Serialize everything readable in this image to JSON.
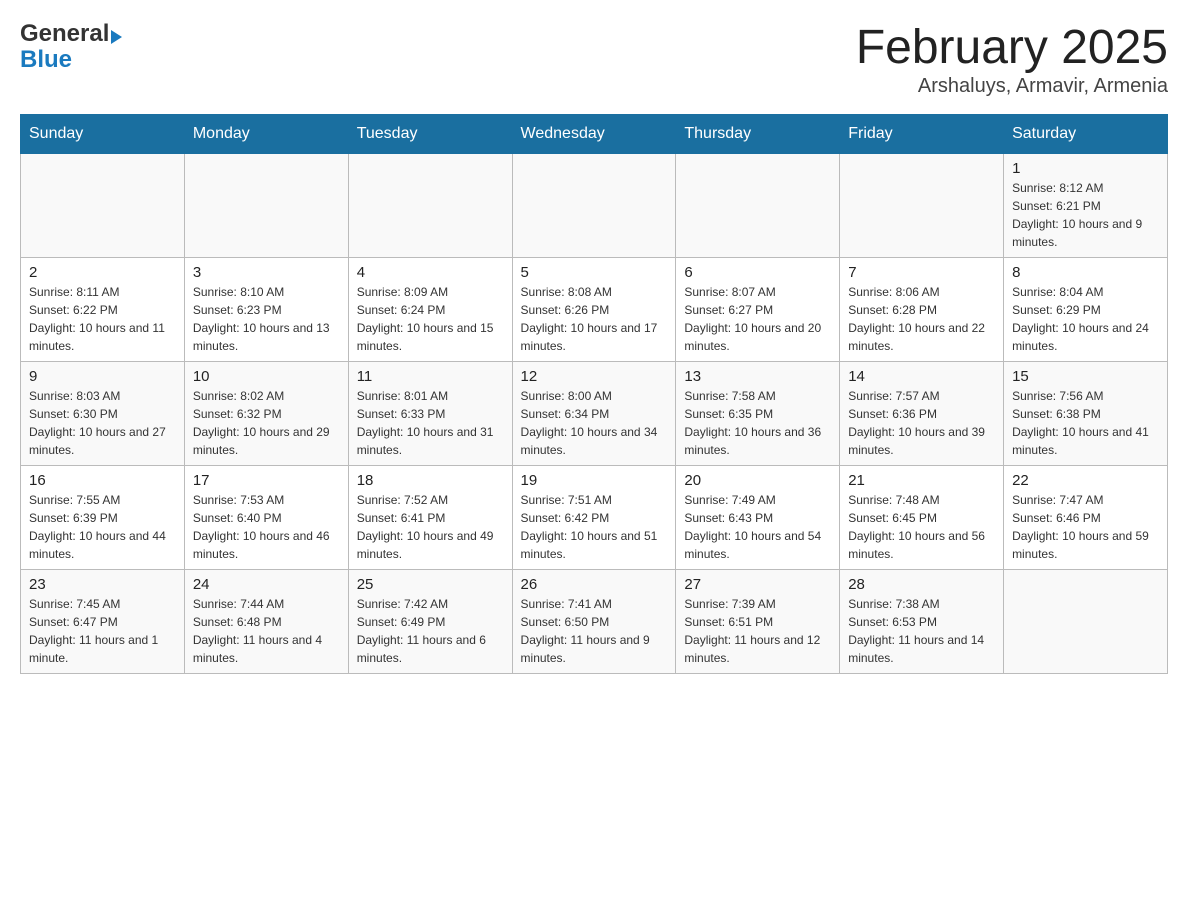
{
  "header": {
    "logo_general": "General",
    "logo_blue": "Blue",
    "title": "February 2025",
    "subtitle": "Arshaluys, Armavir, Armenia"
  },
  "days_of_week": [
    "Sunday",
    "Monday",
    "Tuesday",
    "Wednesday",
    "Thursday",
    "Friday",
    "Saturday"
  ],
  "weeks": [
    [
      {
        "day": "",
        "info": ""
      },
      {
        "day": "",
        "info": ""
      },
      {
        "day": "",
        "info": ""
      },
      {
        "day": "",
        "info": ""
      },
      {
        "day": "",
        "info": ""
      },
      {
        "day": "",
        "info": ""
      },
      {
        "day": "1",
        "info": "Sunrise: 8:12 AM\nSunset: 6:21 PM\nDaylight: 10 hours and 9 minutes."
      }
    ],
    [
      {
        "day": "2",
        "info": "Sunrise: 8:11 AM\nSunset: 6:22 PM\nDaylight: 10 hours and 11 minutes."
      },
      {
        "day": "3",
        "info": "Sunrise: 8:10 AM\nSunset: 6:23 PM\nDaylight: 10 hours and 13 minutes."
      },
      {
        "day": "4",
        "info": "Sunrise: 8:09 AM\nSunset: 6:24 PM\nDaylight: 10 hours and 15 minutes."
      },
      {
        "day": "5",
        "info": "Sunrise: 8:08 AM\nSunset: 6:26 PM\nDaylight: 10 hours and 17 minutes."
      },
      {
        "day": "6",
        "info": "Sunrise: 8:07 AM\nSunset: 6:27 PM\nDaylight: 10 hours and 20 minutes."
      },
      {
        "day": "7",
        "info": "Sunrise: 8:06 AM\nSunset: 6:28 PM\nDaylight: 10 hours and 22 minutes."
      },
      {
        "day": "8",
        "info": "Sunrise: 8:04 AM\nSunset: 6:29 PM\nDaylight: 10 hours and 24 minutes."
      }
    ],
    [
      {
        "day": "9",
        "info": "Sunrise: 8:03 AM\nSunset: 6:30 PM\nDaylight: 10 hours and 27 minutes."
      },
      {
        "day": "10",
        "info": "Sunrise: 8:02 AM\nSunset: 6:32 PM\nDaylight: 10 hours and 29 minutes."
      },
      {
        "day": "11",
        "info": "Sunrise: 8:01 AM\nSunset: 6:33 PM\nDaylight: 10 hours and 31 minutes."
      },
      {
        "day": "12",
        "info": "Sunrise: 8:00 AM\nSunset: 6:34 PM\nDaylight: 10 hours and 34 minutes."
      },
      {
        "day": "13",
        "info": "Sunrise: 7:58 AM\nSunset: 6:35 PM\nDaylight: 10 hours and 36 minutes."
      },
      {
        "day": "14",
        "info": "Sunrise: 7:57 AM\nSunset: 6:36 PM\nDaylight: 10 hours and 39 minutes."
      },
      {
        "day": "15",
        "info": "Sunrise: 7:56 AM\nSunset: 6:38 PM\nDaylight: 10 hours and 41 minutes."
      }
    ],
    [
      {
        "day": "16",
        "info": "Sunrise: 7:55 AM\nSunset: 6:39 PM\nDaylight: 10 hours and 44 minutes."
      },
      {
        "day": "17",
        "info": "Sunrise: 7:53 AM\nSunset: 6:40 PM\nDaylight: 10 hours and 46 minutes."
      },
      {
        "day": "18",
        "info": "Sunrise: 7:52 AM\nSunset: 6:41 PM\nDaylight: 10 hours and 49 minutes."
      },
      {
        "day": "19",
        "info": "Sunrise: 7:51 AM\nSunset: 6:42 PM\nDaylight: 10 hours and 51 minutes."
      },
      {
        "day": "20",
        "info": "Sunrise: 7:49 AM\nSunset: 6:43 PM\nDaylight: 10 hours and 54 minutes."
      },
      {
        "day": "21",
        "info": "Sunrise: 7:48 AM\nSunset: 6:45 PM\nDaylight: 10 hours and 56 minutes."
      },
      {
        "day": "22",
        "info": "Sunrise: 7:47 AM\nSunset: 6:46 PM\nDaylight: 10 hours and 59 minutes."
      }
    ],
    [
      {
        "day": "23",
        "info": "Sunrise: 7:45 AM\nSunset: 6:47 PM\nDaylight: 11 hours and 1 minute."
      },
      {
        "day": "24",
        "info": "Sunrise: 7:44 AM\nSunset: 6:48 PM\nDaylight: 11 hours and 4 minutes."
      },
      {
        "day": "25",
        "info": "Sunrise: 7:42 AM\nSunset: 6:49 PM\nDaylight: 11 hours and 6 minutes."
      },
      {
        "day": "26",
        "info": "Sunrise: 7:41 AM\nSunset: 6:50 PM\nDaylight: 11 hours and 9 minutes."
      },
      {
        "day": "27",
        "info": "Sunrise: 7:39 AM\nSunset: 6:51 PM\nDaylight: 11 hours and 12 minutes."
      },
      {
        "day": "28",
        "info": "Sunrise: 7:38 AM\nSunset: 6:53 PM\nDaylight: 11 hours and 14 minutes."
      },
      {
        "day": "",
        "info": ""
      }
    ]
  ]
}
